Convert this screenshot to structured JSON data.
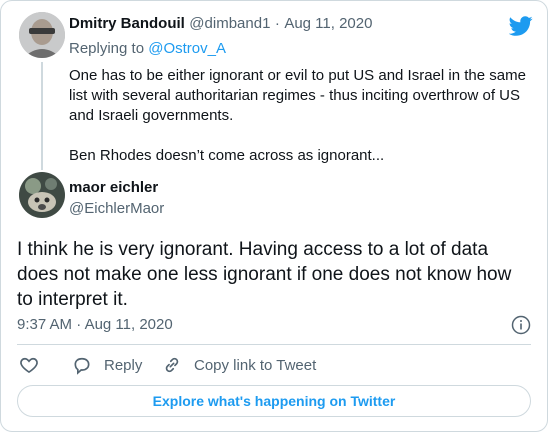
{
  "parent": {
    "display_name": "Dmitry Bandouil",
    "handle": "@dimband1",
    "date": "Aug 11, 2020",
    "replying_prefix": "Replying to ",
    "replying_to": "@Ostrov_A",
    "text_para1": "One has to be either ignorant or evil to put US and Israel in the same list with several authoritarian regimes - thus inciting overthrow of US and Israeli governments.",
    "text_para2": "Ben Rhodes doesn’t come across as ignorant..."
  },
  "main": {
    "display_name": "maor eichler",
    "handle": "@EichlerMaor",
    "text": "I think he is very ignorant. Having access to a lot of data does not make one less ignorant if one does not know how to interpret it.",
    "time": "9:37 AM",
    "date": "Aug 11, 2020"
  },
  "actions": {
    "reply_label": "Reply",
    "copy_link_label": "Copy link to Tweet"
  },
  "explore_label": "Explore what's happening on Twitter",
  "colors": {
    "accent": "#1d9bf0",
    "text": "#0f1419",
    "secondary": "#536471",
    "border": "#cfd9de"
  },
  "icons": [
    "twitter-bird-icon",
    "info-icon",
    "heart-icon",
    "reply-icon",
    "link-icon"
  ]
}
